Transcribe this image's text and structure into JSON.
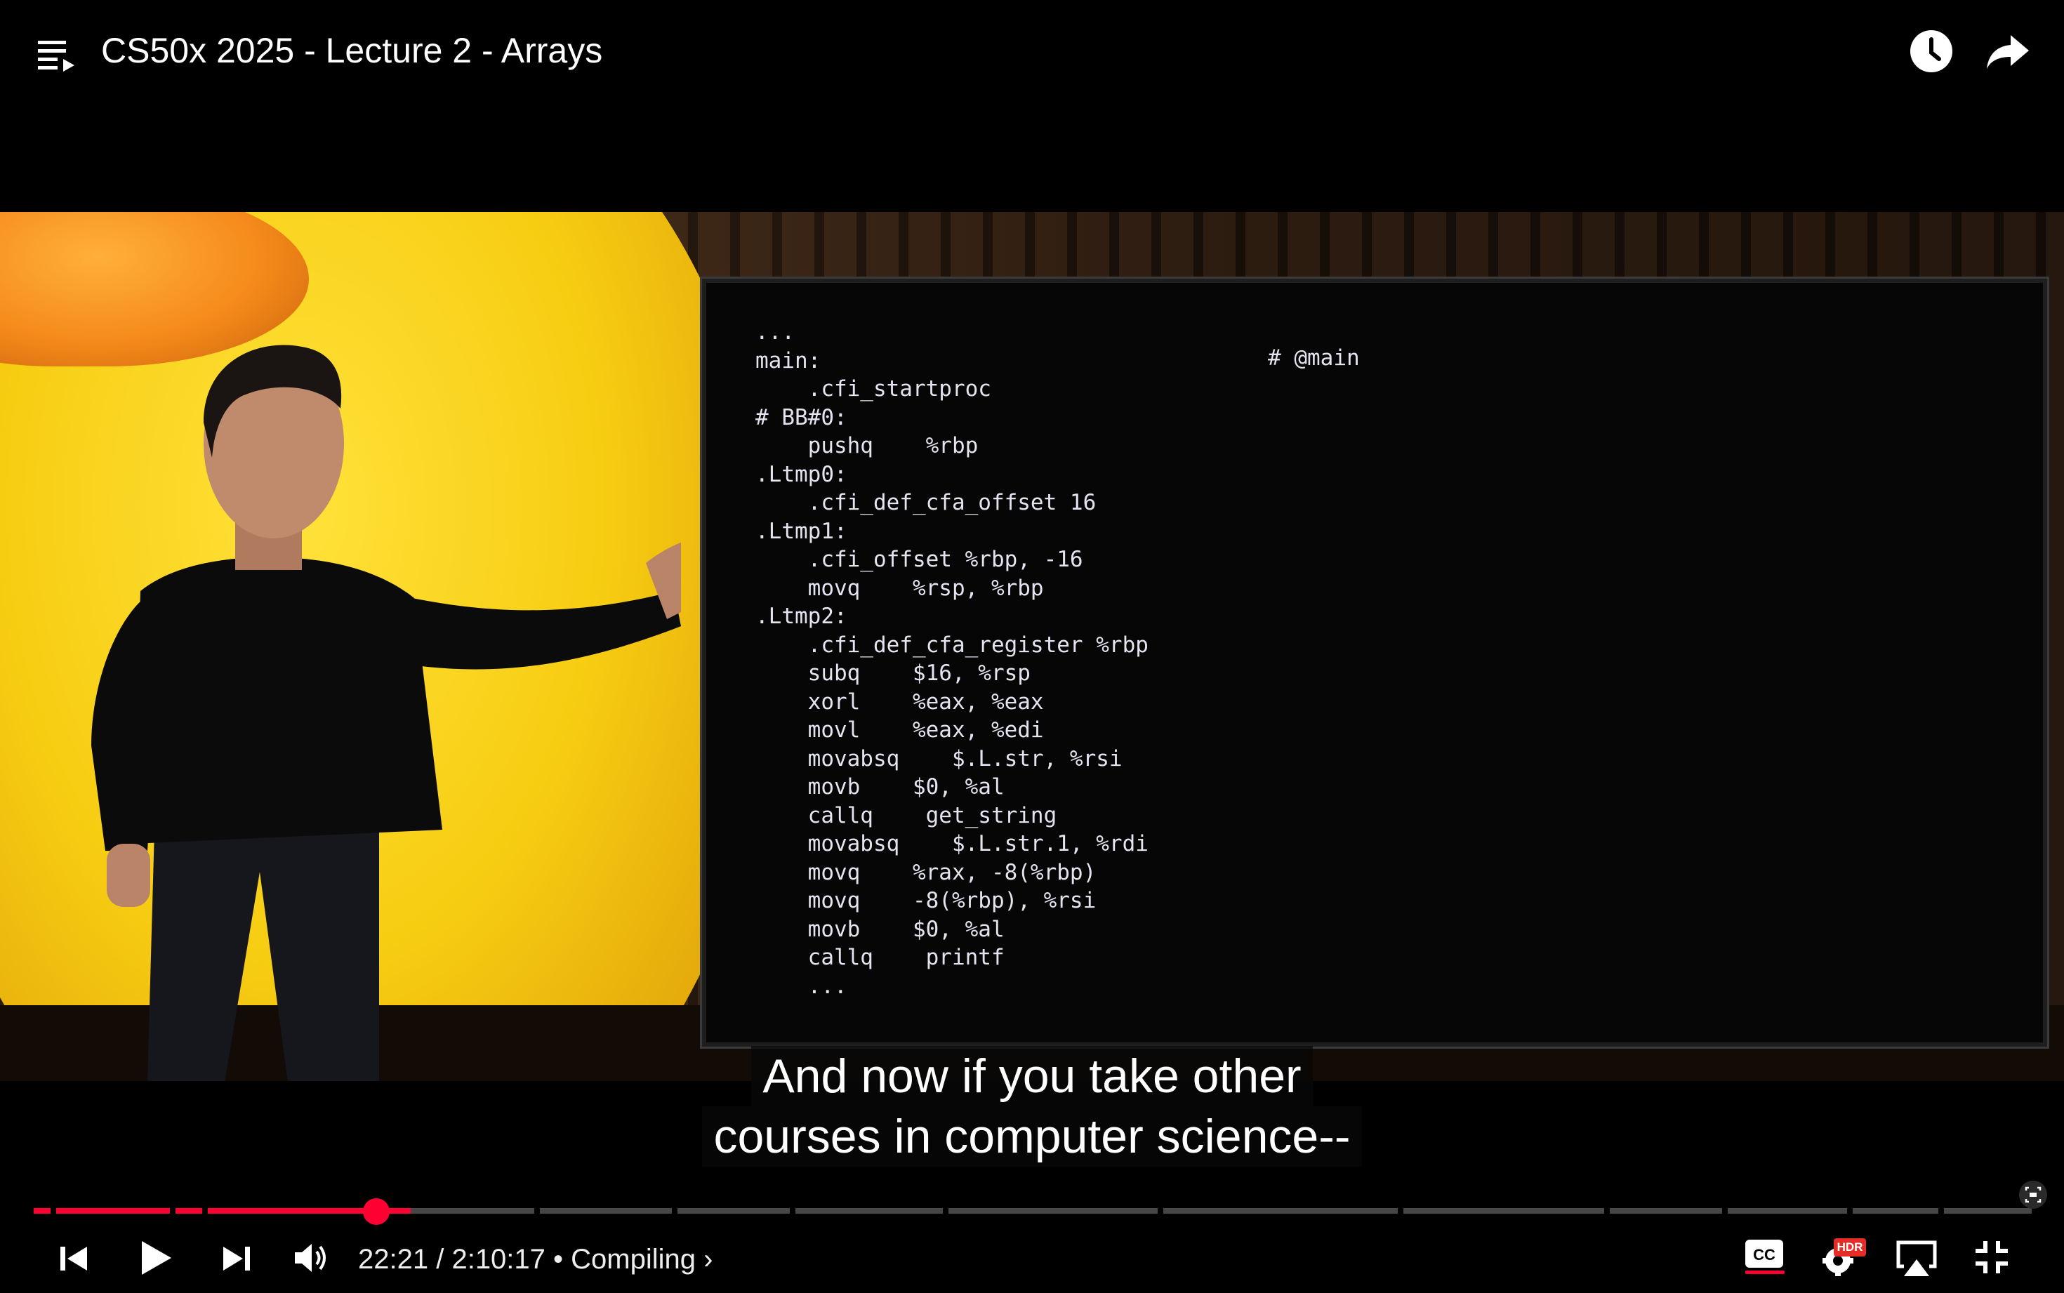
{
  "header": {
    "title": "CS50x 2025 - Lecture 2 - Arrays",
    "icons": [
      "playlist-icon",
      "watch-later-icon",
      "share-icon"
    ]
  },
  "slide": {
    "code_lines": [
      "...",
      "main:",
      "    .cfi_startproc",
      "# BB#0:",
      "    pushq    %rbp",
      ".Ltmp0:",
      "    .cfi_def_cfa_offset 16",
      ".Ltmp1:",
      "    .cfi_offset %rbp, -16",
      "    movq    %rsp, %rbp",
      ".Ltmp2:",
      "    .cfi_def_cfa_register %rbp",
      "    subq    $16, %rsp",
      "    xorl    %eax, %eax",
      "    movl    %eax, %edi",
      "    movabsq    $.L.str, %rsi",
      "    movb    $0, %al",
      "    callq    get_string",
      "    movabsq    $.L.str.1, %rdi",
      "    movq    %rax, -8(%rbp)",
      "    movq    -8(%rbp), %rsi",
      "    movb    $0, %al",
      "    callq    printf",
      "    ..."
    ],
    "comment": "# @main"
  },
  "captions": {
    "line1": "And now if you take other",
    "line2": "courses in computer science--"
  },
  "player": {
    "current_time": "22:21",
    "duration": "2:10:17",
    "separator": " / ",
    "bullet": " • ",
    "chapter": "Compiling",
    "chapter_chevron": "›",
    "progress_fraction": 0.1716,
    "hdr_label": "HDR",
    "accent_color": "#ff0033",
    "controls": [
      "previous-icon",
      "play-icon",
      "next-icon",
      "volume-icon",
      "closed-captions-icon",
      "settings-icon",
      "airplay-icon",
      "exit-fullscreen-icon"
    ]
  }
}
